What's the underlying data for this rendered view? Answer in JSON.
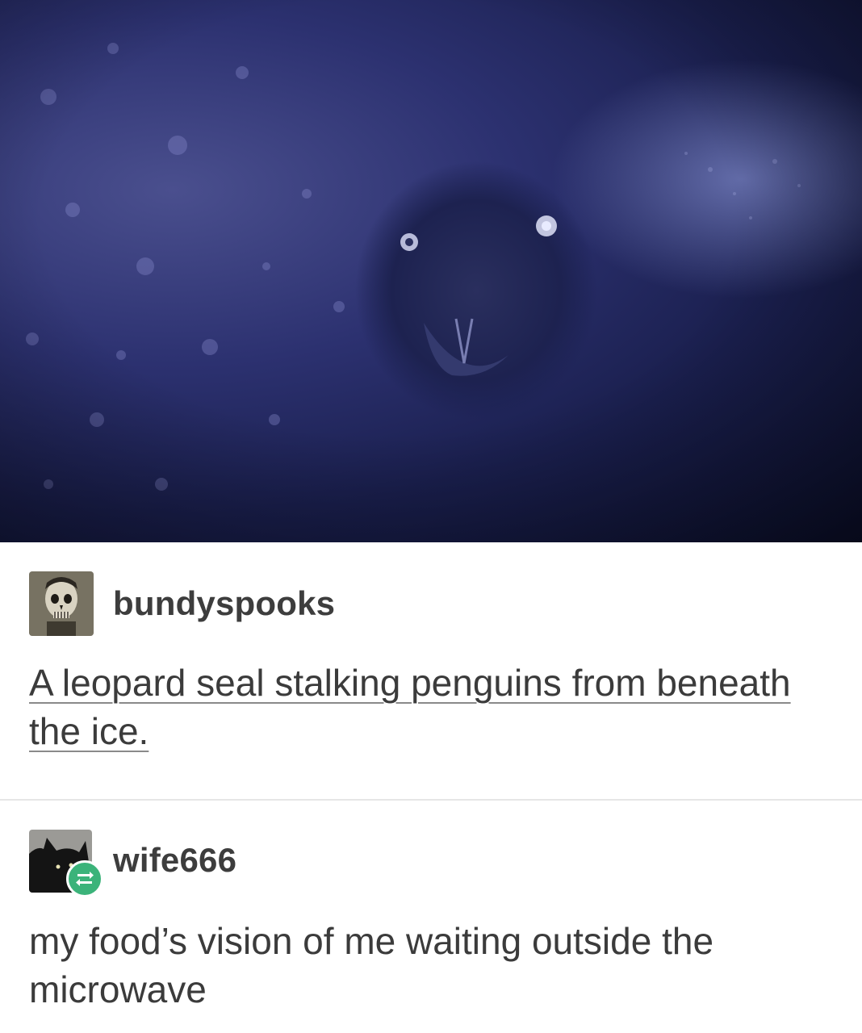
{
  "image": {
    "alt": "",
    "icon": "seal-photo"
  },
  "posts": [
    {
      "username": "bundyspooks",
      "avatar_icon": "skull-portrait-avatar",
      "text": "A leopard seal stalking penguins from beneath the ice."
    },
    {
      "username": "wife666",
      "avatar_icon": "black-cat-avatar",
      "badge_icon": "reblog-icon",
      "text": "my food’s vision of me waiting outside the microwave"
    }
  ],
  "colors": {
    "reblog_badge": "#3bb37a",
    "photo_dark": "#1a1f4e",
    "text": "#3b3b3b"
  }
}
